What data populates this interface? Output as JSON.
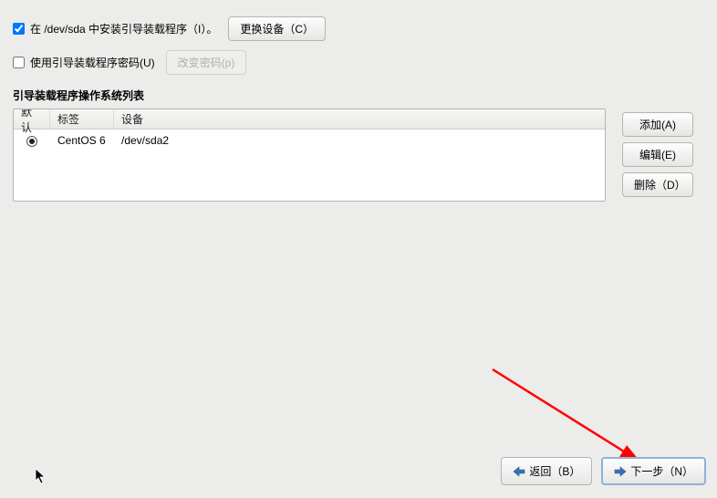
{
  "install_bootloader": {
    "checked": true,
    "label": "在 /dev/sda 中安装引导装载程序（I）。",
    "change_device_btn": "更换设备（C）"
  },
  "use_password": {
    "checked": false,
    "label": "使用引导装载程序密码(U)",
    "change_pw_btn": "改变密码(p)"
  },
  "os_list": {
    "title": "引导装载程序操作系统列表",
    "headers": {
      "default": "默认",
      "label": "标签",
      "device": "设备"
    },
    "rows": [
      {
        "selected": true,
        "label": "CentOS 6",
        "device": "/dev/sda2"
      }
    ]
  },
  "side_buttons": {
    "add": "添加(A)",
    "edit": "编辑(E)",
    "delete": "删除（D）"
  },
  "footer": {
    "back": "返回（B）",
    "next": "下一步（N）"
  }
}
